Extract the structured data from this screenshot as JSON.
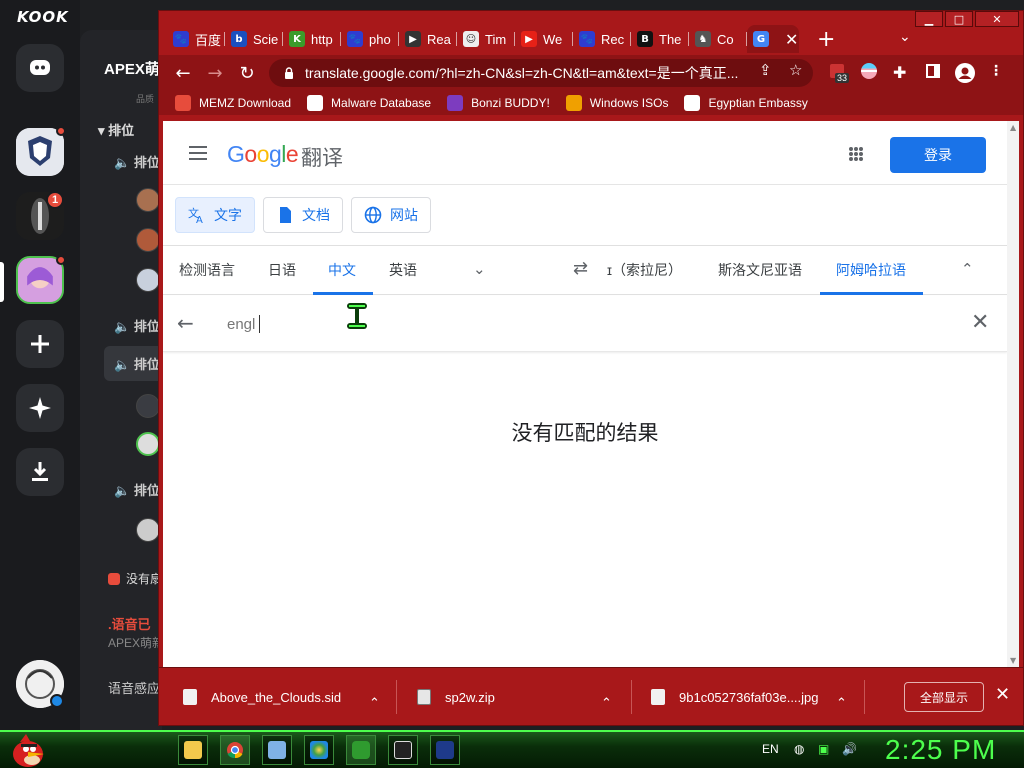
{
  "kook": {
    "logo": "KOOK",
    "server_name": "APEX萌",
    "server_sub": "品质",
    "category": "排位",
    "voice_channels": [
      "排位",
      "排位",
      "排位",
      "排位"
    ],
    "badge_count": "1",
    "warning_text": "没有扇",
    "alert_title": ".语音已",
    "alert_sub": "APEX萌新",
    "bottom_text": "语音感应"
  },
  "chrome": {
    "window_controls": {
      "min": "▁",
      "max": "□",
      "close": "✕"
    },
    "tabs": [
      {
        "label": "百度",
        "fav_color": "#2f3cd0",
        "fav_glyph": "🐾"
      },
      {
        "label": "Scie",
        "fav_color": "#1b4fbf",
        "fav_glyph": "b"
      },
      {
        "label": "http",
        "fav_color": "#3b9b2a",
        "fav_glyph": "K"
      },
      {
        "label": "pho",
        "fav_color": "#2f3cd0",
        "fav_glyph": "🐾"
      },
      {
        "label": "Rea",
        "fav_color": "#333333",
        "fav_glyph": "▶"
      },
      {
        "label": "Tim",
        "fav_color": "#eeeeee",
        "fav_glyph": "☺"
      },
      {
        "label": "We",
        "fav_color": "#e62117",
        "fav_glyph": "▶"
      },
      {
        "label": "Rec",
        "fav_color": "#2f3cd0",
        "fav_glyph": "🐾"
      },
      {
        "label": "The",
        "fav_color": "#111111",
        "fav_glyph": "B"
      },
      {
        "label": "Co",
        "fav_color": "#555555",
        "fav_glyph": "♞"
      },
      {
        "label": "",
        "fav_color": "#4285f4",
        "fav_glyph": "G",
        "active": true
      }
    ],
    "new_tab": "+",
    "tab_search": "⌄",
    "url": "translate.google.com/?hl=zh-CN&sl=zh-CN&tl=am&text=是一个真正...",
    "ext_badge": "33",
    "bookmarks": [
      {
        "label": "MEMZ Download",
        "color": "#e74c3c"
      },
      {
        "label": "Malware Database",
        "color": "#ffffff"
      },
      {
        "label": "Bonzi BUDDY!",
        "color": "#7d3cbf"
      },
      {
        "label": "Windows ISOs",
        "color": "#f0a000"
      },
      {
        "label": "Egyptian Embassy",
        "color": "#ffffff"
      }
    ]
  },
  "translate": {
    "logo": {
      "G": "G",
      "o1": "o",
      "o2": "o",
      "g": "g",
      "l": "l",
      "e": "e"
    },
    "title": "翻译",
    "signin": "登录",
    "modes": [
      "文字",
      "文档",
      "网站"
    ],
    "source_langs": [
      "检测语言",
      "日语",
      "中文",
      "英语"
    ],
    "target_langs": [
      "ɪ（索拉尼）",
      "斯洛文尼亚语",
      "阿姆哈拉语"
    ],
    "search_value": "engl",
    "no_results": "没有匹配的结果"
  },
  "downloads": {
    "items": [
      "Above_the_Clouds.sid",
      "sp2w.zip",
      "9b1c052736faf03e....jpg"
    ],
    "show_all": "全部显示"
  },
  "taskbar": {
    "lang": "EN",
    "time": "2:25 PM"
  }
}
